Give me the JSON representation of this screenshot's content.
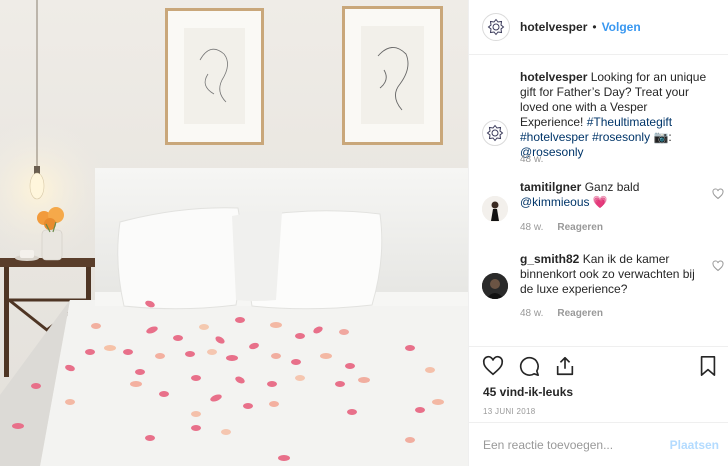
{
  "header": {
    "username": "hotelvesper",
    "separator": "•",
    "follow_label": "Volgen"
  },
  "caption": {
    "username": "hotelvesper",
    "text": "Looking for an unique gift for Father’s Day? Treat your loved one with a Vesper Experience!",
    "tags_line1": "#Theultimategift #hotelvesper",
    "tags_line2_tag": "#rosesonly",
    "camera_glyph": "📷",
    "tags_line2_mid": ": ",
    "tags_line2_mention": "@rosesonly",
    "age": "48 w."
  },
  "comments": [
    {
      "username": "tamitilgner",
      "text": "Ganz bald ",
      "mention": "@kimmieous",
      "emoji": "💗",
      "age": "48 w.",
      "reply_label": "Reageren"
    },
    {
      "username": "g_smith82",
      "text": "Kan ik de kamer binnenkort ook zo verwachten bij de luxe experience?",
      "age": "48 w.",
      "reply_label": "Reageren"
    }
  ],
  "actions": {
    "icons": [
      "heart-icon",
      "comment-icon",
      "share-icon",
      "bookmark-icon"
    ]
  },
  "likes": "45 vind-ik-leuks",
  "date": "13 JUNI 2018",
  "add_comment": {
    "placeholder": "Een reactie toevoegen...",
    "post_label": "Plaatsen"
  },
  "colors": {
    "link": "#3897f0",
    "hashtag": "#003569",
    "meta": "#999999",
    "post_disabled": "#b3dbff",
    "petal_pink": "#e8708a"
  }
}
